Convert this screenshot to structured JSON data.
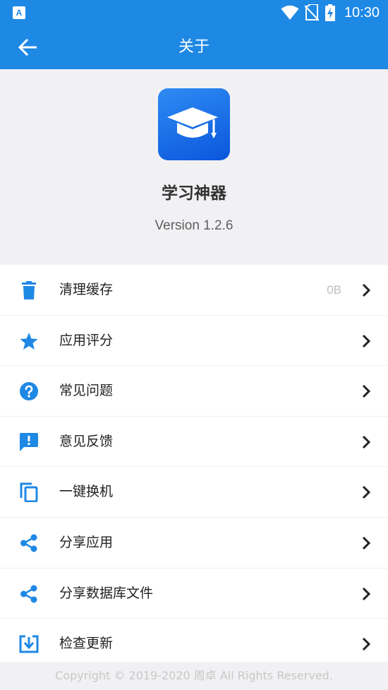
{
  "status_bar": {
    "time": "10:30",
    "icons": [
      "notification-a-icon",
      "wifi-icon",
      "no-sim-icon",
      "battery-charging-icon"
    ]
  },
  "app_bar": {
    "title": "关于",
    "back_icon": "arrow-back-icon"
  },
  "header": {
    "app_icon": "graduation-cap-icon",
    "app_name": "学习神器",
    "version": "Version 1.2.6"
  },
  "colors": {
    "primary": "#1e88e5",
    "icon_blue": "#1e88e5",
    "background": "#f1f1f4"
  },
  "menu": {
    "items": [
      {
        "icon": "trash-icon",
        "label": "清理缓存",
        "value": "0B"
      },
      {
        "icon": "star-icon",
        "label": "应用评分",
        "value": ""
      },
      {
        "icon": "help-icon",
        "label": "常见问题",
        "value": ""
      },
      {
        "icon": "feedback-icon",
        "label": "意见反馈",
        "value": ""
      },
      {
        "icon": "copy-icon",
        "label": "一键换机",
        "value": ""
      },
      {
        "icon": "share-icon",
        "label": "分享应用",
        "value": ""
      },
      {
        "icon": "share-icon",
        "label": "分享数据库文件",
        "value": ""
      },
      {
        "icon": "download-icon",
        "label": "检查更新",
        "value": ""
      }
    ]
  },
  "footer": {
    "copyright": "Copyright © 2019-2020 周卓 All Rights Reserved."
  }
}
